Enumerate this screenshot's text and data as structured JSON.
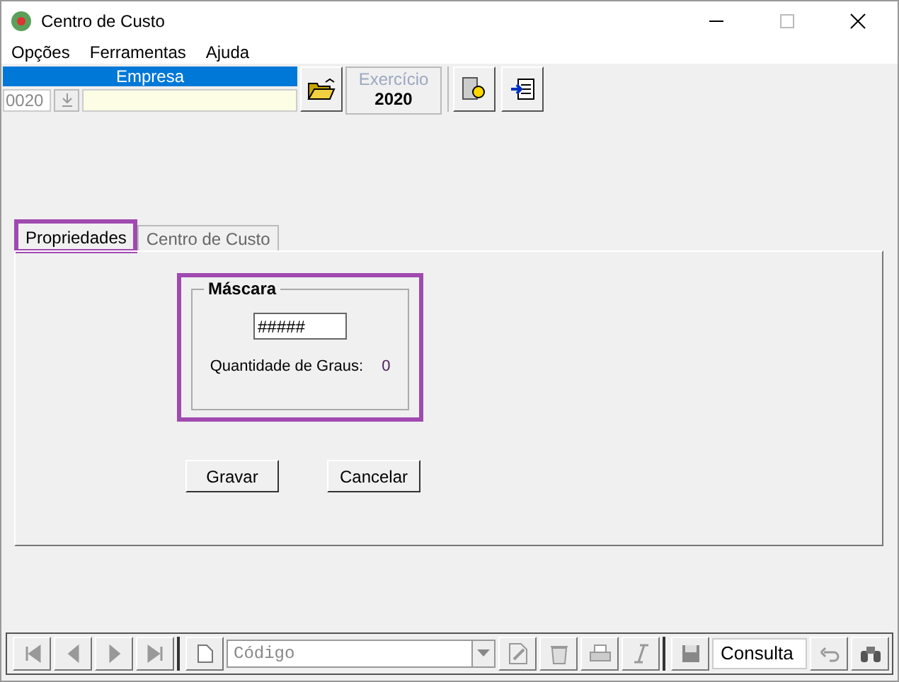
{
  "window": {
    "title": "Centro de Custo"
  },
  "menu": [
    {
      "label": "Opções"
    },
    {
      "label": "Ferramentas"
    },
    {
      "label": "Ajuda"
    }
  ],
  "empresa": {
    "header": "Empresa",
    "code": "0020"
  },
  "exercicio": {
    "label": "Exercício",
    "value": "2020"
  },
  "tabs": [
    {
      "label": "Propriedades",
      "selected": true,
      "highlighted": true
    },
    {
      "label": "Centro de Custo",
      "selected": false,
      "highlighted": false
    }
  ],
  "mascara": {
    "title": "Máscara",
    "value": "#####",
    "highlighted": true,
    "graus_label": "Quantidade de Graus:",
    "graus_value": "0"
  },
  "buttons": [
    {
      "label": "Gravar"
    },
    {
      "label": "Cancelar"
    }
  ],
  "navbar": {
    "search": {
      "placeholder": "Código"
    },
    "mode": "Consulta"
  }
}
